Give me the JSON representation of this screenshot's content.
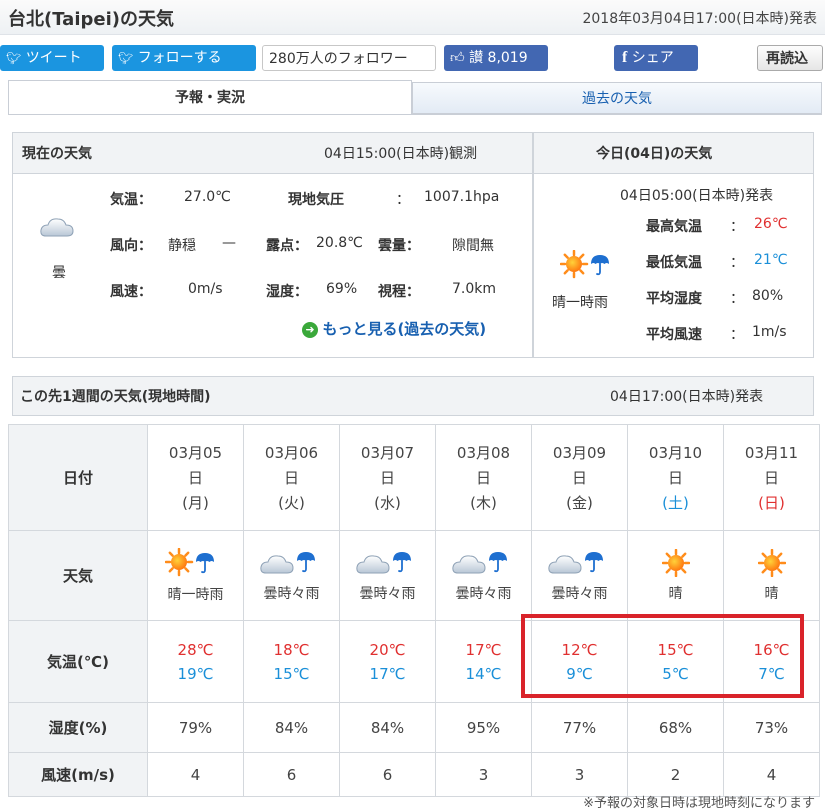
{
  "header": {
    "title": "台北(Taipei)の天気",
    "issued": "2018年03月04日17:00(日本時)発表"
  },
  "social": {
    "tweet": "ツイート",
    "follow": "フォローする",
    "followers": "280万人のフォロワー",
    "like_count": "8,019",
    "like_label": "讃",
    "share": "シェア",
    "reload": "再読込"
  },
  "tabs": [
    "予報・実況",
    "過去の天気"
  ],
  "current": {
    "heading": "現在の天気",
    "observed": "04日15:00(日本時)観測",
    "icon_label": "曇",
    "temp_label": "気温：",
    "temp": "27.0℃",
    "pressure_label": "現地気圧",
    "pressure_sep": "：",
    "pressure": "1007.1hpa",
    "wind_dir_label": "風向：",
    "wind_dir": "静穏",
    "wind_dash": "—",
    "dew_label": "露点：",
    "dew": "20.8℃",
    "cloud_label": "雲量：",
    "cloud": "隙間無",
    "wind_speed_label": "風速：",
    "wind_speed": "0m/s",
    "humidity_label": "湿度：",
    "humidity": "69%",
    "visibility_label": "視程：",
    "visibility": "7.0km",
    "more_link": "もっと見る(過去の天気)"
  },
  "today": {
    "heading": "今日(04日)の天気",
    "issued": "04日05:00(日本時)発表",
    "icon_label": "晴一時雨",
    "max_label": "最高気温",
    "max": "26℃",
    "min_label": "最低気温",
    "min": "21℃",
    "avg_hum_label": "平均湿度",
    "avg_hum": "80%",
    "avg_wind_label": "平均風速",
    "avg_wind": "1m/s",
    "sep": "："
  },
  "weekly": {
    "heading": "この先1週間の天気(現地時間)",
    "issued": "04日17:00(日本時)発表",
    "row_labels": [
      "日付",
      "天気",
      "気温(℃)",
      "湿度(%)",
      "風速(m/s)"
    ],
    "days": [
      {
        "date": "03月05",
        "day": "日",
        "dow": "(月)",
        "weather": "晴一時雨",
        "icon": "sun-umbrella-icon",
        "hi": "28℃",
        "lo": "19℃",
        "humidity": "79%",
        "wind": "4"
      },
      {
        "date": "03月06",
        "day": "日",
        "dow": "(火)",
        "weather": "曇時々雨",
        "icon": "cloud-umbrella-icon",
        "hi": "18℃",
        "lo": "15℃",
        "humidity": "84%",
        "wind": "6"
      },
      {
        "date": "03月07",
        "day": "日",
        "dow": "(水)",
        "weather": "曇時々雨",
        "icon": "cloud-umbrella-icon",
        "hi": "20℃",
        "lo": "17℃",
        "humidity": "84%",
        "wind": "6"
      },
      {
        "date": "03月08",
        "day": "日",
        "dow": "(木)",
        "weather": "曇時々雨",
        "icon": "cloud-umbrella-icon",
        "hi": "17℃",
        "lo": "14℃",
        "humidity": "95%",
        "wind": "3"
      },
      {
        "date": "03月09",
        "day": "日",
        "dow": "(金)",
        "weather": "曇時々雨",
        "icon": "cloud-umbrella-icon",
        "hi": "12℃",
        "lo": "9℃",
        "humidity": "77%",
        "wind": "3"
      },
      {
        "date": "03月10",
        "day": "日",
        "dow": "(土)",
        "weather": "晴",
        "icon": "sun-icon",
        "hi": "15℃",
        "lo": "5℃",
        "humidity": "68%",
        "wind": "2"
      },
      {
        "date": "03月11",
        "day": "日",
        "dow": "(日)",
        "weather": "晴",
        "icon": "sun-icon",
        "hi": "16℃",
        "lo": "7℃",
        "humidity": "73%",
        "wind": "4"
      }
    ],
    "footnote": "※予報の対象日時は現地時刻になります"
  },
  "colors": {
    "hi": "#e03030",
    "lo": "#1a8fd8",
    "saturday": "#1a8fd8",
    "sunday": "#e03030",
    "highlight": "#d9232a",
    "link": "#1860b0"
  }
}
